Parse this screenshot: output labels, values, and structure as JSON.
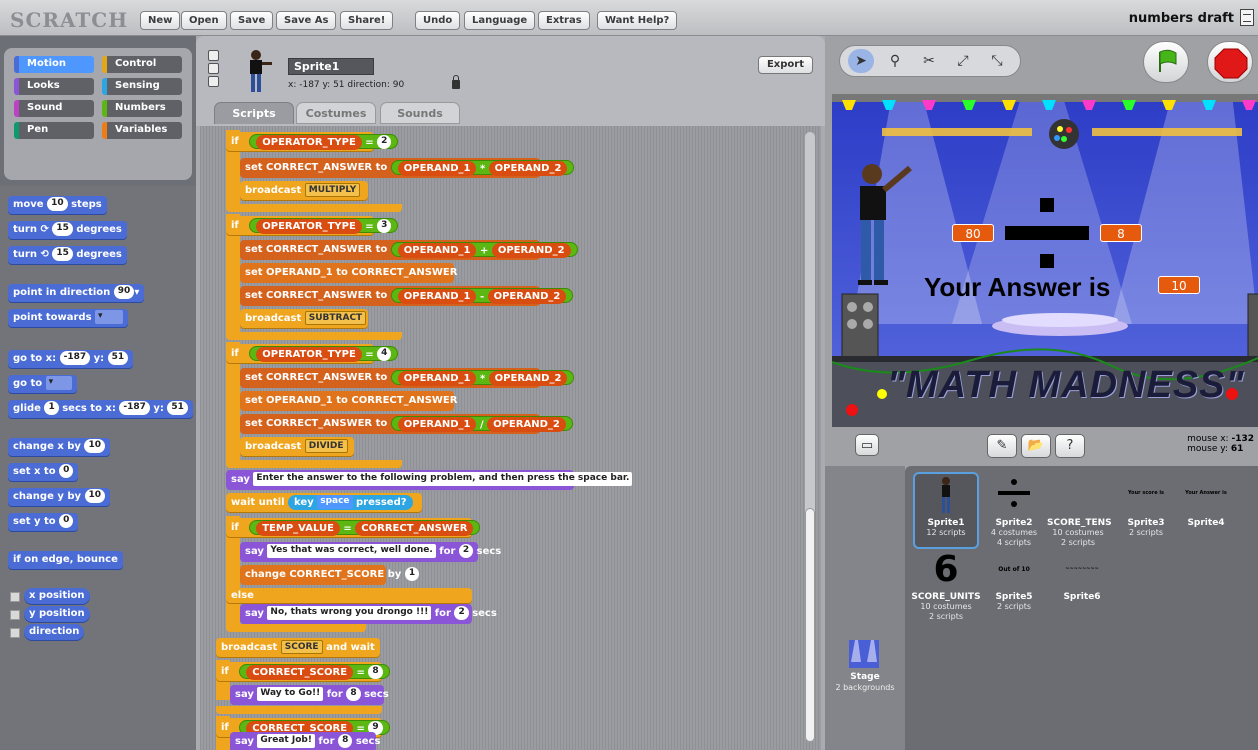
{
  "app": {
    "logo": "SCRATCH",
    "project_name": "numbers draft"
  },
  "menu": [
    "New",
    "Open",
    "Save",
    "Save As",
    "Share!",
    "Undo",
    "Language",
    "Extras",
    "Want Help?"
  ],
  "categories": [
    {
      "label": "Motion",
      "color": "#4a6cd4",
      "selected": true
    },
    {
      "label": "Control",
      "color": "#e1a91a",
      "selected": false
    },
    {
      "label": "Looks",
      "color": "#8a55d7",
      "selected": false
    },
    {
      "label": "Sensing",
      "color": "#2ca5e2",
      "selected": false
    },
    {
      "label": "Sound",
      "color": "#bb42c3",
      "selected": false
    },
    {
      "label": "Numbers",
      "color": "#5cb712",
      "selected": false
    },
    {
      "label": "Pen",
      "color": "#0e9a6c",
      "selected": false
    },
    {
      "label": "Variables",
      "color": "#ee7d16",
      "selected": false
    }
  ],
  "palette": {
    "move": {
      "a": "move",
      "v": "10",
      "b": "steps"
    },
    "turn_cw": {
      "a": "turn",
      "v": "15",
      "b": "degrees"
    },
    "turn_ccw": {
      "a": "turn",
      "v": "15",
      "b": "degrees"
    },
    "point_dir": {
      "a": "point in direction",
      "v": "90"
    },
    "point_towards": {
      "a": "point towards"
    },
    "goto_xy": {
      "a": "go to x:",
      "x": "-187",
      "y_label": "y:",
      "y": "51"
    },
    "goto": {
      "a": "go to"
    },
    "glide": {
      "a": "glide",
      "secs": "1",
      "b": "secs to x:",
      "x": "-187",
      "y_label": "y:",
      "y": "51"
    },
    "change_x": {
      "a": "change x by",
      "v": "10"
    },
    "set_x": {
      "a": "set x to",
      "v": "0"
    },
    "change_y": {
      "a": "change y by",
      "v": "10"
    },
    "set_y": {
      "a": "set y to",
      "v": "0"
    },
    "bounce": {
      "a": "if on edge, bounce"
    },
    "reporters": [
      "x position",
      "y position",
      "direction"
    ]
  },
  "sprite": {
    "name": "Sprite1",
    "coords": "x: -187  y: 51   direction: 90",
    "export": "Export"
  },
  "tabs": [
    "Scripts",
    "Costumes",
    "Sounds"
  ],
  "code": {
    "if": "if",
    "else": "else",
    "eq": "=",
    "operator_type": "OPERATOR_TYPE",
    "set": "set",
    "to": "to",
    "correct_answer": "CORRECT_ANSWER",
    "operand_1": "OPERAND_1",
    "operand_2": "OPERAND_2",
    "broadcast": "broadcast",
    "v2": "2",
    "v3": "3",
    "v4": "4",
    "op_mul": "*",
    "op_add": "+",
    "op_sub": "-",
    "op_div": "/",
    "multiply": "MULTIPLY",
    "subtract": "SUBTRACT",
    "divide": "DIVIDE",
    "say": "say",
    "say_prompt": "Enter the answer to the following problem, and then press the space bar.",
    "wait_until": "wait until",
    "key": "key",
    "space": "space",
    "pressed": "pressed?",
    "temp_value": "TEMP_VALUE",
    "correct_msg": "Yes that was correct, well done.",
    "for": "for",
    "secs": "secs",
    "two": "2",
    "change": "change",
    "correct_score": "CORRECT_SCORE",
    "by": "by",
    "one": "1",
    "wrong_msg": "No, thats wrong you drongo !!!",
    "score": "SCORE",
    "and_wait": "and wait",
    "eight": "8",
    "nine": "9",
    "way_to_go": "Way to Go!!",
    "great_job": "Great Job!"
  },
  "stage": {
    "operand_1": "80",
    "operand_2": "8",
    "answer_label": "Your Answer is",
    "answer_value": "10",
    "banner": "\"MATH MADNESS\"",
    "mouse_x_label": "mouse x:",
    "mouse_x": "-132",
    "mouse_y_label": "mouse y:",
    "mouse_y": "61"
  },
  "sprites": [
    {
      "name": "Sprite1",
      "line1": "12 scripts",
      "line2": ""
    },
    {
      "name": "Sprite2",
      "line1": "4 costumes",
      "line2": "4 scripts"
    },
    {
      "name": "SCORE_TENS",
      "line1": "10 costumes",
      "line2": "2 scripts"
    },
    {
      "name": "Sprite3",
      "line1": "2 scripts",
      "line2": ""
    },
    {
      "name": "Sprite4",
      "line1": "",
      "line2": ""
    },
    {
      "name": "SCORE_UNITS",
      "line1": "10 costumes",
      "line2": "2 scripts"
    },
    {
      "name": "Sprite5",
      "line1": "2 scripts",
      "line2": ""
    },
    {
      "name": "Sprite6",
      "line1": "",
      "line2": ""
    }
  ],
  "sprite_thumb_texts": {
    "sprite3": "Your score is",
    "sprite4": "Your Answer is",
    "sprite5": "Out of 10",
    "sprite6": "~~~~~~~~",
    "score_units_digit": "6"
  },
  "stage_item": {
    "name": "Stage",
    "sub": "2 backgrounds"
  }
}
